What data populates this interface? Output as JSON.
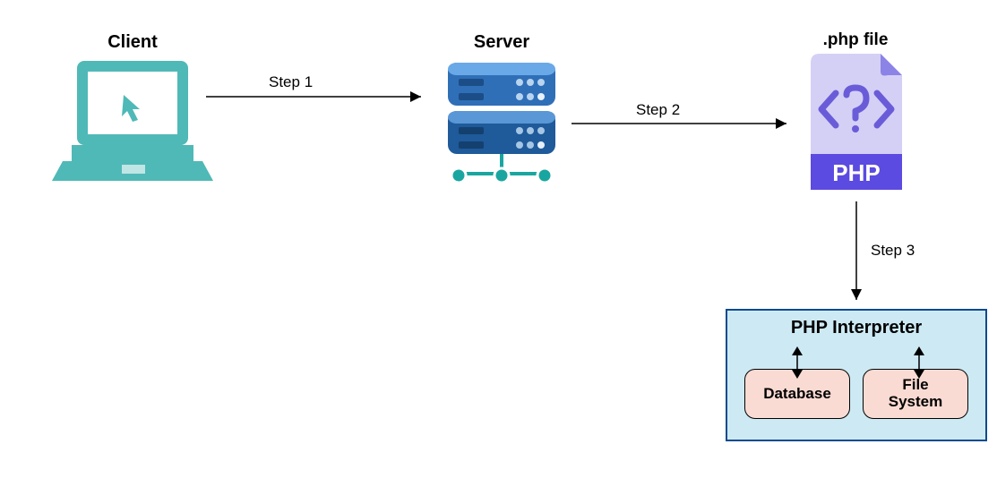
{
  "nodes": {
    "client": {
      "label": "Client"
    },
    "server": {
      "label": "Server"
    },
    "phpfile": {
      "label": ".php file",
      "tag_text": "PHP"
    },
    "interpreter": {
      "title": "PHP Interpreter",
      "database": "Database",
      "filesystem": "File\nSystem"
    }
  },
  "edges": {
    "step1": "Step 1",
    "step2": "Step 2",
    "step3": "Step 3"
  }
}
